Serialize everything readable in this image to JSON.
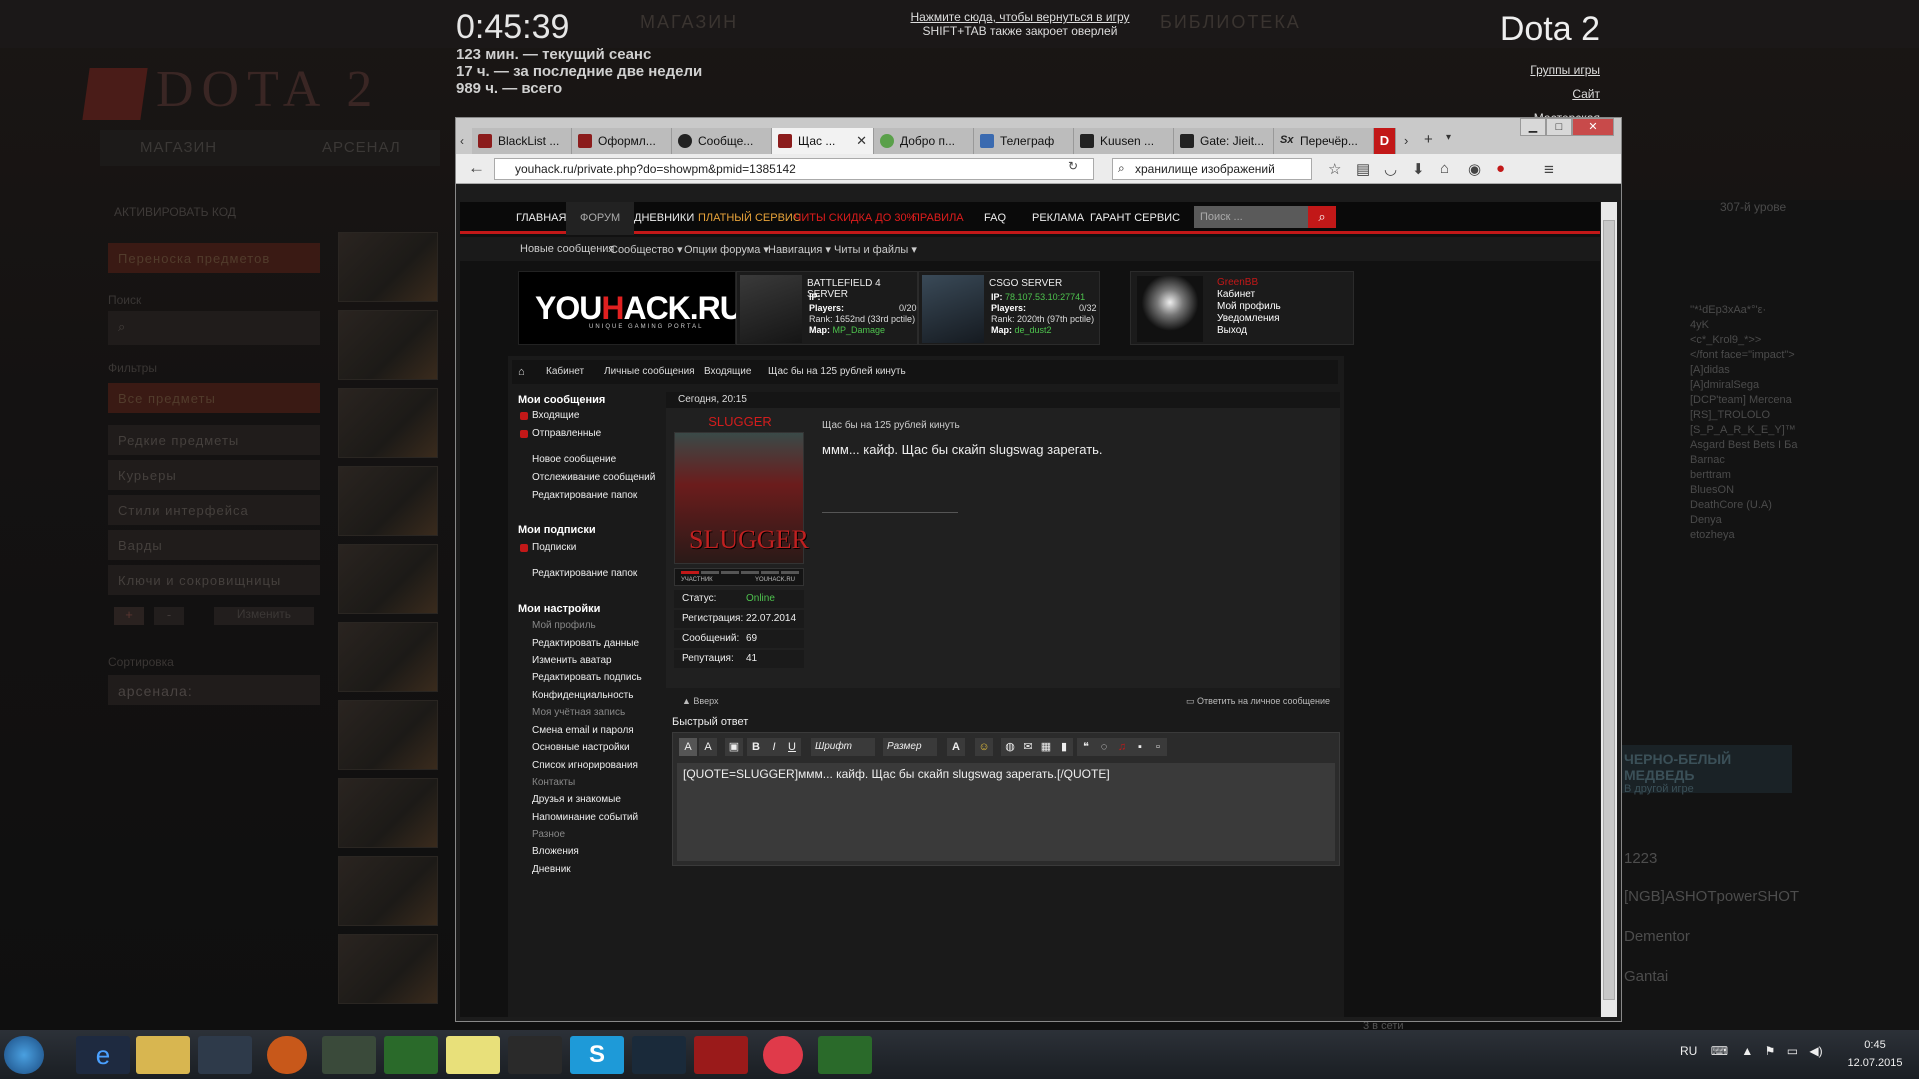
{
  "overlay": {
    "clock": "0:45:39",
    "stats": [
      "123 мин. — текущий сеанс",
      "17 ч. — за последние две недели",
      "989 ч. — всего"
    ],
    "return_link": "Нажмите сюда, чтобы вернуться в игру",
    "return_hint": "SHIFT+TAB также закроет оверлей",
    "game_title": "Dota 2",
    "links": [
      "Группы игры",
      "Сайт",
      "Мастерская"
    ]
  },
  "dota": {
    "logo": "DOTA 2",
    "top_tabs": [
      "МАГАЗИН",
      "БИБЛИОТЕКА"
    ],
    "subtabs": [
      "МАГАЗИН",
      "АРСЕНАЛ"
    ],
    "activate": "АКТИВИРОВАТЬ КОД",
    "transfer": "Переноска предметов",
    "search_label": "Поиск",
    "filters_label": "Фильтры",
    "filters": [
      "Все предметы",
      "Редкие предметы",
      "Курьеры",
      "Стили интерфейса",
      "Варды",
      "Ключи и сокровищницы"
    ],
    "edit_label": "Изменить",
    "sort_label": "Сортировка",
    "sort_value": "арсенала:",
    "level": "307-й урове",
    "friends": [
      "''*¹dEp3xAa*°'ε·",
      "4yK",
      "<c*_Krol9_*>>",
      "</font face=\"impact\">",
      "[A]didas",
      "[A]dmiralSega",
      "[DCP'team] Mercena",
      "[RS]_TROLOLO",
      "[S_P_A_R_K_E_Y]™",
      "Asgard Best Bets I Ба",
      "Barnac",
      "berttram",
      "BluesON",
      "DeathCore (U.A)",
      "Denya",
      "etozheya"
    ],
    "bear": "ЧЕРНО-БЕЛЫЙ МЕДВЕДЬ",
    "bear_sub": "В другой игре",
    "chat_names": [
      "1223",
      "[NGB]ASHOTpowerSHOT",
      "Dementor",
      "Gantai"
    ],
    "online": "3 в сети"
  },
  "browser": {
    "tabs": [
      "BlackList ...",
      "Оформл...",
      "Сообще...",
      "Щас ...",
      "Добро п...",
      "Телеграф",
      "Kuusen ...",
      "Gate: Jieit...",
      "Перечёр..."
    ],
    "url": "youhack.ru/private.php?do=showpm&pmid=1385142",
    "search": "хранилище изображений"
  },
  "site": {
    "nav": [
      "ГЛАВНАЯ",
      "ФОРУМ",
      "ДНЕВНИКИ",
      "ПЛАТНЫЙ СЕРВИС",
      "ЧИТЫ СКИДКА ДО 30%",
      "ПРАВИЛА",
      "FAQ",
      "РЕКЛАМА",
      "ГАРАНТ СЕРВИС"
    ],
    "nav_colors": {
      "paid": "#e8a33a",
      "cheats": "#e01c1c",
      "rules": "#e01c1c"
    },
    "search_placeholder": "Поиск ...",
    "subnav": [
      "Новые сообщения",
      "Сообщество ▾",
      "Опции форума ▾",
      "Навигация ▾",
      "Читы и файлы ▾"
    ],
    "logo_a": "YOU",
    "logo_b": "H",
    "logo_c": "ACK.RU",
    "logo_sub": "UNIQUE GAMING PORTAL",
    "bf": {
      "name": "BATTLEFIELD 4 SERVER",
      "ip": "IP:",
      "players_label": "Players:",
      "players": "0/20",
      "rank": "Rank: 1652nd (33rd pctile)",
      "map_label": "Map:",
      "map": "MP_Damage"
    },
    "cs": {
      "name": "CSGO SERVER",
      "ip_label": "IP:",
      "ip": "78.107.53.10:27741",
      "players_label": "Players:",
      "players": "0/32",
      "rank": "Rank: 2020th (97th pctile)",
      "map_label": "Map:",
      "map": "de_dust2"
    },
    "user": {
      "name": "GreenBB",
      "links": [
        "Кабинет",
        "Мой профиль",
        "Уведомления",
        "Выход"
      ]
    },
    "crumbs": [
      "Кабинет",
      "Личные сообщения",
      "Входящие",
      "Щас бы на 125 рублей кинуть"
    ],
    "sidebar": {
      "h1": "Мои сообщения",
      "msgs": [
        "Входящие",
        "Отправленные"
      ],
      "msg_opts": [
        "Новое сообщение",
        "Отслеживание сообщений",
        "Редактирование папок"
      ],
      "h2": "Мои подписки",
      "subs": [
        "Подписки"
      ],
      "sub_opts": [
        "Редактирование папок"
      ],
      "h3": "Мои настройки",
      "g_profile": "Мой профиль",
      "profile": [
        "Редактировать данные",
        "Изменить аватар",
        "Редактировать подпись",
        "Конфиденциальность"
      ],
      "g_account": "Моя учётная запись",
      "account": [
        "Смена email и пароля",
        "Основные настройки",
        "Список игнорирования"
      ],
      "g_contacts": "Контакты",
      "contacts": [
        "Друзья и знакомые",
        "Напоминание событий"
      ],
      "g_misc": "Разное",
      "misc": [
        "Вложения",
        "Дневник"
      ]
    },
    "post": {
      "date": "Сегодня, 20:15",
      "author": "SLUGGER",
      "avatar_text": "SLUGGER",
      "rank_label": "УЧАСТНИК",
      "rank_site": "YOUHACK.RU",
      "status_label": "Статус:",
      "status": "Online",
      "reg_label": "Регистрация:",
      "reg": "22.07.2014",
      "msgs_label": "Сообщений:",
      "msgs": "69",
      "rep_label": "Репутация:",
      "rep": "41",
      "title": "Щас бы на 125 рублей кинуть",
      "text": "ммм... кайф. Щас бы скайп slugswag зарегать.",
      "up": "Вверх",
      "reply": "Ответить на личное сообщение"
    },
    "quick_reply": "Быстрый ответ",
    "font_label": "Шрифт",
    "size_label": "Размер",
    "editor_text": "[QUOTE=SLUGGER]ммм... кайф. Щас бы скайп slugswag зарегать.[/QUOTE]"
  },
  "taskbar": {
    "lang": "RU",
    "time": "0:45",
    "date": "12.07.2015"
  }
}
